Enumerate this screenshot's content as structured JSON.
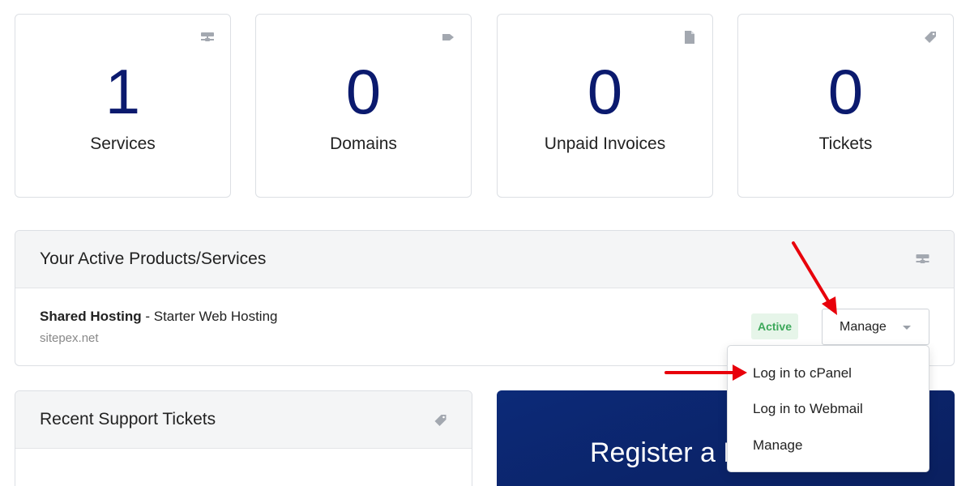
{
  "stats": [
    {
      "number": "1",
      "label": "Services",
      "icon": "server-icon"
    },
    {
      "number": "0",
      "label": "Domains",
      "icon": "tag-icon"
    },
    {
      "number": "0",
      "label": "Unpaid Invoices",
      "icon": "document-icon"
    },
    {
      "number": "0",
      "label": "Tickets",
      "icon": "ticket-icon"
    }
  ],
  "products_panel": {
    "title": "Your Active Products/Services",
    "product_name": "Shared Hosting",
    "product_separator": " - ",
    "product_plan": "Starter Web Hosting",
    "product_domain": "sitepex.net",
    "status": "Active",
    "manage_label": "Manage"
  },
  "manage_menu": {
    "items": [
      "Log in to cPanel",
      "Log in to Webmail",
      "Manage"
    ]
  },
  "tickets_panel": {
    "title": "Recent Support Tickets"
  },
  "register_panel": {
    "text": "Register a N"
  },
  "colors": {
    "stat_number": "#0b1a6e",
    "active_badge_bg": "#e6f5e9",
    "active_badge_text": "#3ca85a",
    "register_bg": "#0c2a78",
    "annotation_arrow": "#e8000b"
  }
}
